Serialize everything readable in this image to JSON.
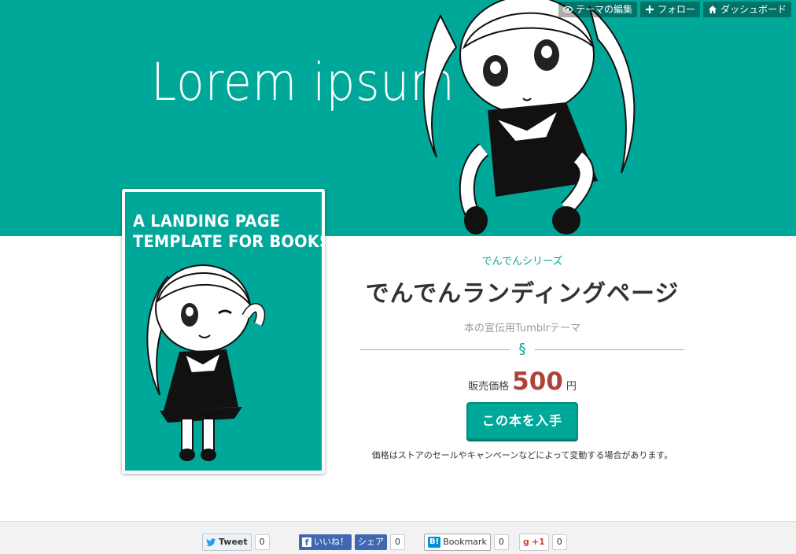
{
  "hero": {
    "title": "Lorem ipsum"
  },
  "tumblr_controls": [
    {
      "label": "テーマの編集",
      "icon": "eye-icon"
    },
    {
      "label": "フォロー",
      "icon": "plus-icon"
    },
    {
      "label": "ダッシュボード",
      "icon": "home-icon"
    }
  ],
  "cover": {
    "title_line1": "A LANDING PAGE",
    "title_line2": "TEMPLATE FOR BOOKS"
  },
  "book": {
    "series": "でんでんシリーズ",
    "title": "でんでんランディングページ",
    "subtitle": "本の宣伝用Tumblrテーマ",
    "divider_mark": "§",
    "price_label": "販売価格",
    "price_value": "500",
    "price_unit": "円",
    "buy_label": "この本を入手",
    "note": "価格はストアのセールやキャンペーンなどによって変動する場合があります。"
  },
  "share": {
    "tweet_label": "Tweet",
    "tweet_count": "0",
    "fb_like_label": "いいね！",
    "fb_share_label": "シェア",
    "fb_count": "0",
    "hatena_logo": "B!",
    "hatena_label": "Bookmark",
    "hatena_count": "0",
    "gplus_label": "+1",
    "gplus_count": "0"
  },
  "colors": {
    "accent": "#00a89a",
    "price": "#b0413a",
    "facebook": "#4267b2",
    "hatena": "#008fde"
  }
}
